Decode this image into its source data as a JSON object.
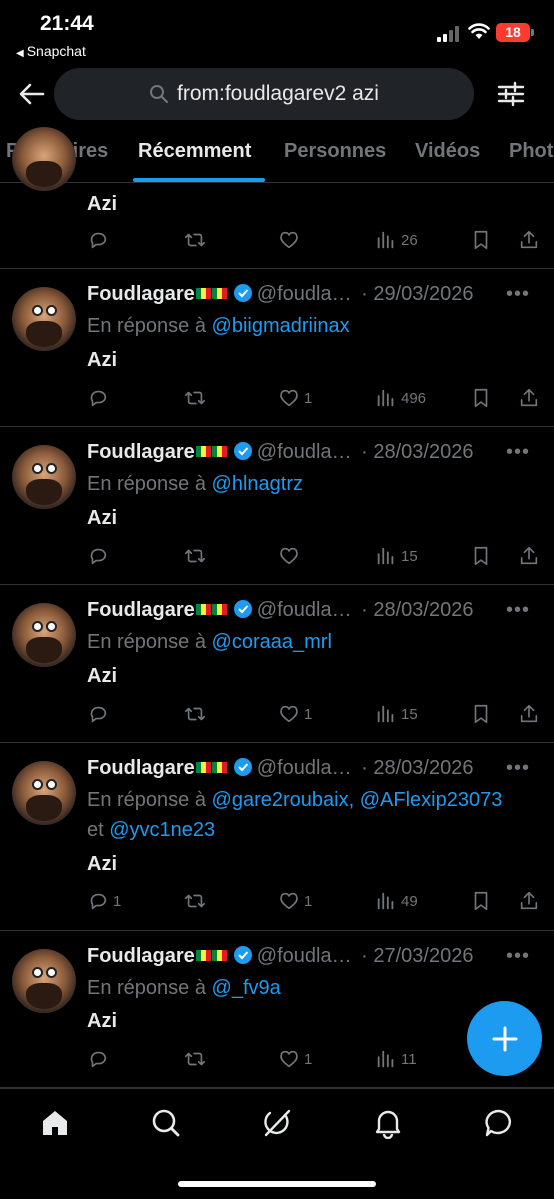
{
  "status_bar": {
    "time": "21:44",
    "back_app": "Snapchat",
    "battery": "18"
  },
  "search": {
    "query": "from:foudlagarev2 azi"
  },
  "tabs": [
    {
      "label": "Populaires",
      "active": false
    },
    {
      "label": "Récemment",
      "active": true
    },
    {
      "label": "Personnes",
      "active": false
    },
    {
      "label": "Vidéos",
      "active": false
    },
    {
      "label": "Phot",
      "active": false
    }
  ],
  "partial_tweet": {
    "text": "Azi",
    "views": "26"
  },
  "tweets": [
    {
      "name": "Foudlagare",
      "handle": "@foudla…",
      "date": "· 29/03/2026",
      "reply_prefix": "En réponse à",
      "mentions": "@biigmadriinax",
      "text": "Azi",
      "replies": "",
      "retweets": "",
      "likes": "1",
      "views": "496"
    },
    {
      "name": "Foudlagare",
      "handle": "@foudla…",
      "date": "· 28/03/2026",
      "reply_prefix": "En réponse à",
      "mentions": "@hlnagtrz",
      "text": "Azi",
      "replies": "",
      "retweets": "",
      "likes": "",
      "views": "15"
    },
    {
      "name": "Foudlagare",
      "handle": "@foudla…",
      "date": "· 28/03/2026",
      "reply_prefix": "En réponse à",
      "mentions": "@coraaa_mrl",
      "text": "Azi",
      "replies": "",
      "retweets": "",
      "likes": "1",
      "views": "15"
    },
    {
      "name": "Foudlagare",
      "handle": "@foudla…",
      "date": "· 28/03/2026",
      "reply_prefix": "En réponse à",
      "mentions": "@gare2roubaix, @AFlexip23073",
      "mentions_line2_prefix": "et",
      "mentions_line2": "@yvc1ne23",
      "text": "Azi",
      "replies": "1",
      "retweets": "",
      "likes": "1",
      "views": "49"
    },
    {
      "name": "Foudlagare",
      "handle": "@foudla…",
      "date": "· 27/03/2026",
      "reply_prefix": "En réponse à",
      "mentions": "@_fv9a",
      "text": "Azi",
      "replies": "",
      "retweets": "",
      "likes": "1",
      "views": "11"
    }
  ],
  "colors": {
    "accent": "#1d9bf0",
    "background": "#000000",
    "muted": "#71767b",
    "text": "#e7e9ea"
  },
  "icons": [
    "back-arrow-icon",
    "search-icon",
    "filter-icon",
    "reply-icon",
    "retweet-icon",
    "like-icon",
    "views-icon",
    "bookmark-icon",
    "share-icon",
    "compose-icon",
    "home-icon",
    "explore-icon",
    "grok-icon",
    "notifications-icon",
    "messages-icon"
  ]
}
